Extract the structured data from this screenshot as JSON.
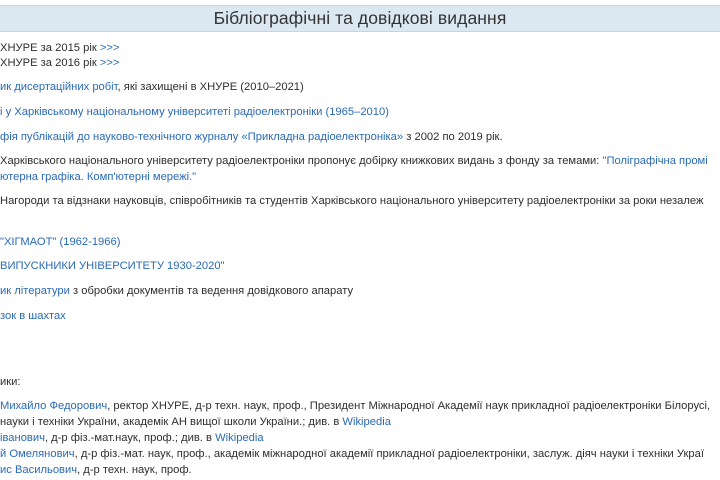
{
  "header": {
    "title": "Бібліографічні та довідкові видання"
  },
  "items": {
    "y2015": {
      "text": " ХНУРЕ за 2015 рік ",
      "more": ">>>"
    },
    "y2016": {
      "text": " ХНУРЕ за 2016 рік ",
      "more": ">>>"
    },
    "dissertations": {
      "link": "ик дисертаційних робіт",
      "rest": ", які захищені в ХНУРЕ (2010–2021)"
    },
    "khnure": {
      "link": "і у Харківському національному університеті радіоелектроніки (1965–2010)"
    },
    "journal": {
      "link": "фія публікацій до науково-технічного журналу «Прикладна радіоелектроніка»",
      "rest": " з 2002 по 2019 рік."
    },
    "books": {
      "text": "Харківського національного університету радіоелектроніки пропонує добірку книжкових видань з фонду за темами: ",
      "link1": "\"Поліграфічна промі",
      "link2": "ютерна графіка. Комп'ютерні мережі.\""
    },
    "awards": {
      "text": "Нагороди та відзнаки науковців, співробітників та студентів Харківського національного університету радіоелектроніки за роки незалеж"
    },
    "higmaot": {
      "link": "\"ХІГМАОТ\" (1962-1966)"
    },
    "graduates": {
      "link": "ВИПУСКНИКИ УНІВЕРСИТЕТУ 1930-2020\""
    },
    "literature": {
      "link": "ик літератури",
      "rest": " з обробки документів та ведення довідкового апарату"
    },
    "chess": {
      "link": "зок в шахтах"
    }
  },
  "people": {
    "heading": "ики:",
    "p1": {
      "link": "Михайло Федорович",
      "rest": ", ректор ХНУРЕ, д-р техн. наук, проф., Президент Міжнародної Академії наук прикладної радіоелектроніки Білорусі,",
      "line2": "науки і техніки України, академік АН вищої школи України.; див. в ",
      "wiki": "Wikipedia"
    },
    "p2": {
      "link": "іванович",
      "rest": ", д-р фіз.-мат.наук, проф.; див. в ",
      "wiki": "Wikipedia"
    },
    "p3": {
      "link": "й Омелянович",
      "rest": ", д-р фіз.-мат. наук, проф., академік міжнародної академії прикладної радіоелектроніки, заслуж. діяч науки і техніки Украї"
    },
    "p4": {
      "link": "ис Васильович",
      "rest": ", д-р техн. наук, проф."
    }
  }
}
